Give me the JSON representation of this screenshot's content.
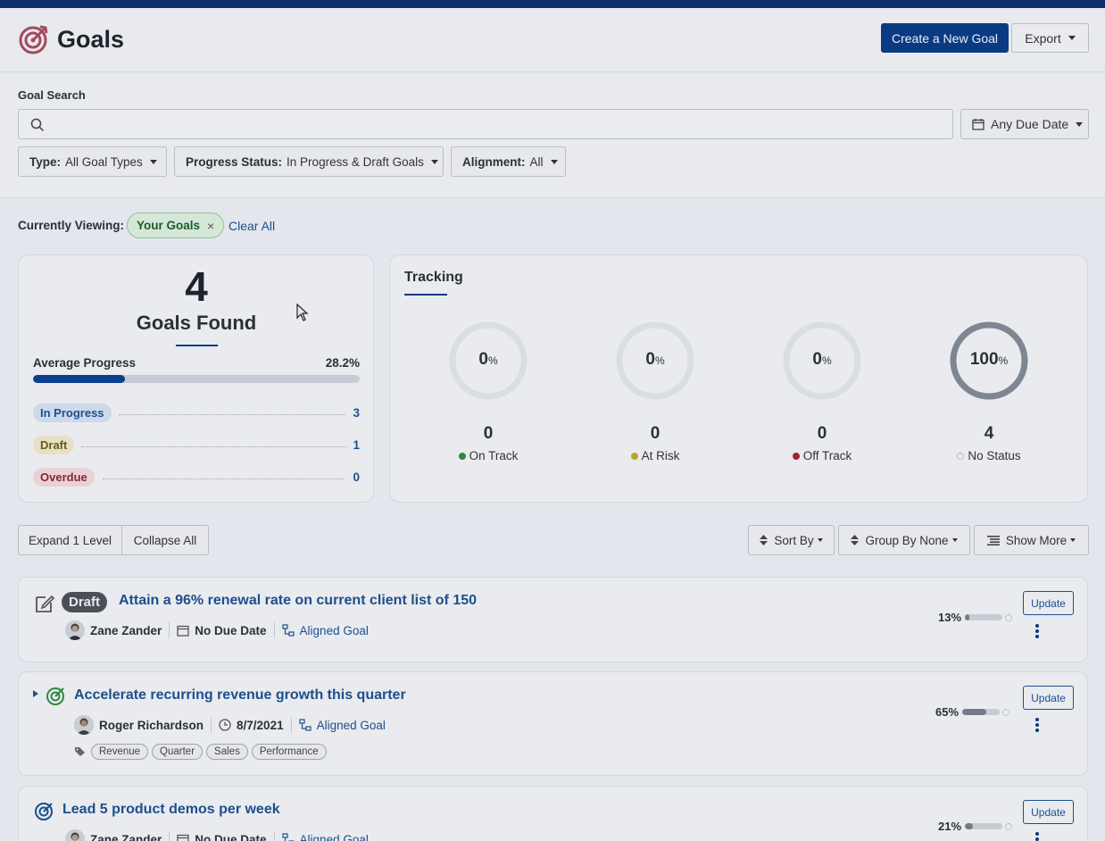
{
  "header": {
    "title": "Goals",
    "create_label": "Create a New Goal",
    "export_label": "Export"
  },
  "search": {
    "label": "Goal Search",
    "value": "",
    "placeholder": "",
    "due_date_label": "Any Due Date"
  },
  "filters": {
    "type_key": "Type:",
    "type_value": "All Goal Types",
    "progress_key": "Progress Status:",
    "progress_value": "In Progress & Draft Goals",
    "alignment_key": "Alignment:",
    "alignment_value": "All"
  },
  "viewing": {
    "label": "Currently Viewing:",
    "chip": "Your Goals",
    "chip_close": "×",
    "clear_all": "Clear All"
  },
  "summary": {
    "count": "4",
    "found_label": "Goals Found",
    "avg_label": "Average Progress",
    "avg_value": "28.2%",
    "avg_fraction": 0.282,
    "statuses": [
      {
        "label": "In Progress",
        "count": "3",
        "color": "#1d4f8c",
        "bg": "#cdd8ea"
      },
      {
        "label": "Draft",
        "count": "1",
        "color": "#6b5a1e",
        "bg": "#e6e0c4"
      },
      {
        "label": "Overdue",
        "count": "0",
        "color": "#8a2432",
        "bg": "#e8d2d6"
      }
    ]
  },
  "tracking": {
    "title": "Tracking",
    "items": [
      {
        "pct": "0",
        "pct_sign": "%",
        "count": "0",
        "label": "On Track",
        "color": "#2f8a3f",
        "fraction": 0
      },
      {
        "pct": "0",
        "pct_sign": "%",
        "count": "0",
        "label": "At Risk",
        "color": "#b9a42a",
        "fraction": 0
      },
      {
        "pct": "0",
        "pct_sign": "%",
        "count": "0",
        "label": "Off Track",
        "color": "#a4203a",
        "fraction": 0
      },
      {
        "pct": "100",
        "pct_sign": "%",
        "count": "4",
        "label": "No Status",
        "color": "#8c939e",
        "fraction": 1
      }
    ]
  },
  "toolbar": {
    "expand_label": "Expand 1 Level",
    "collapse_label": "Collapse All",
    "sort_label": "Sort By",
    "group_label": "Group By None",
    "show_more_label": "Show More"
  },
  "goals": [
    {
      "badge": "Draft",
      "title": "Attain a 96% renewal rate on current client list of 150",
      "owner": "Zane Zander",
      "due": "No Due Date",
      "aligned": "Aligned Goal",
      "progress_label": "13%",
      "progress": 0.13,
      "update_label": "Update"
    },
    {
      "title": "Accelerate recurring revenue growth this quarter",
      "owner": "Roger Richardson",
      "due": "8/7/2021",
      "aligned": "Aligned Goal",
      "progress_label": "65%",
      "progress": 0.65,
      "update_label": "Update",
      "tags": [
        "Revenue",
        "Quarter",
        "Sales",
        "Performance"
      ]
    },
    {
      "title": "Lead 5 product demos per week",
      "owner": "Zane Zander",
      "due": "No Due Date",
      "aligned": "Aligned Goal",
      "progress_label": "21%",
      "progress": 0.21,
      "update_label": "Update"
    }
  ]
}
